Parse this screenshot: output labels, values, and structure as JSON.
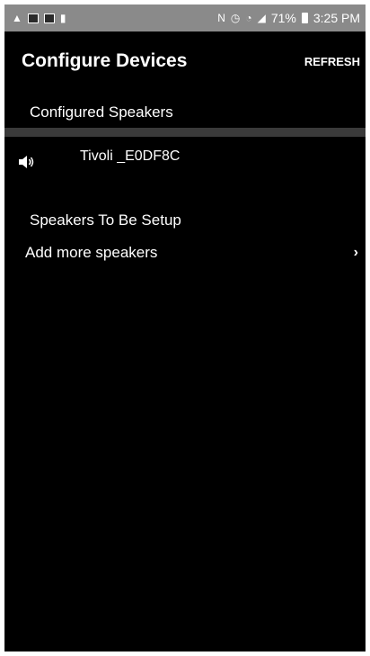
{
  "status_bar": {
    "battery_percent": "71%",
    "time": "3:25 PM",
    "icons": [
      "warning-icon",
      "image-icon",
      "gallery-icon",
      "lock-icon",
      "nfc-icon",
      "alarm-icon",
      "wifi-icon",
      "signal-icon",
      "battery-icon"
    ]
  },
  "header": {
    "title": "Configure Devices",
    "refresh_label": "REFRESH"
  },
  "configured": {
    "section_title": "Configured Speakers",
    "speakers": [
      {
        "name": "Tivoli _E0DF8C",
        "icon": "speaker-icon"
      }
    ]
  },
  "setup": {
    "section_title": "Speakers To Be Setup",
    "add_label": "Add more speakers",
    "chevron": "›"
  }
}
